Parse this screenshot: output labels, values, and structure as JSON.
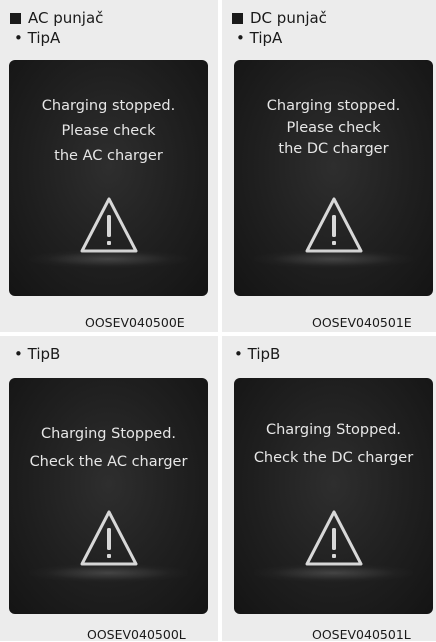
{
  "sections": {
    "ac_title": "AC punjač",
    "dc_title": "DC punjač"
  },
  "panels": [
    {
      "tip": "• TipA",
      "lines": [
        "Charging stopped.",
        "Please check",
        "the AC charger"
      ],
      "code": "OOSEV040500E"
    },
    {
      "tip": "• TipA",
      "lines": [
        "Charging stopped.",
        "Please check",
        "the DC charger"
      ],
      "code": "OOSEV040501E"
    },
    {
      "tip": "• TipB",
      "lines": [
        "Charging Stopped.",
        "Check the AC charger"
      ],
      "code": "OOSEV040500L"
    },
    {
      "tip": "• TipB",
      "lines": [
        "Charging Stopped.",
        "Check the DC charger"
      ],
      "code": "OOSEV040501L"
    }
  ],
  "icons": {
    "warning": "warning-triangle-icon",
    "section_marker": "square-bullet-icon"
  },
  "colors": {
    "screen_background": "#1f1f1f",
    "screen_text": "#e6e6e6",
    "panel_background": "#ececec"
  }
}
